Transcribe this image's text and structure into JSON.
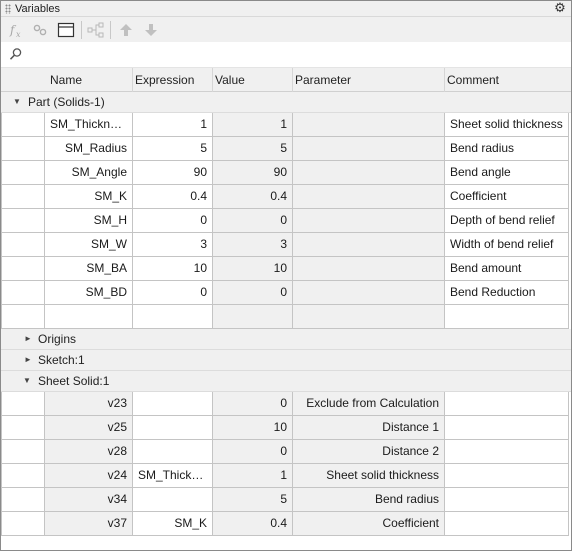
{
  "window": {
    "title": "Variables"
  },
  "toolbar": {
    "buttons": [
      {
        "name": "function-icon"
      },
      {
        "name": "link-icon"
      },
      {
        "name": "window-icon"
      },
      {
        "name": "hierarchy-icon"
      },
      {
        "name": "arrow-up-icon"
      },
      {
        "name": "arrow-down-icon"
      }
    ]
  },
  "search": {
    "value": "",
    "placeholder": ""
  },
  "columns": [
    "Name",
    "Expression",
    "Value",
    "Parameter",
    "Comment"
  ],
  "groups": [
    {
      "label": "Part (Solids-1)",
      "expanded": true,
      "rows": [
        {
          "name": "SM_Thickness",
          "expression": "1",
          "value": "1",
          "parameter": "",
          "comment": "Sheet solid thickness"
        },
        {
          "name": "SM_Radius",
          "expression": "5",
          "value": "5",
          "parameter": "",
          "comment": "Bend radius"
        },
        {
          "name": "SM_Angle",
          "expression": "90",
          "value": "90",
          "parameter": "",
          "comment": "Bend angle"
        },
        {
          "name": "SM_K",
          "expression": "0.4",
          "value": "0.4",
          "parameter": "",
          "comment": "Coefficient"
        },
        {
          "name": "SM_H",
          "expression": "0",
          "value": "0",
          "parameter": "",
          "comment": "Depth of bend relief"
        },
        {
          "name": "SM_W",
          "expression": "3",
          "value": "3",
          "parameter": "",
          "comment": "Width of bend relief"
        },
        {
          "name": "SM_BA",
          "expression": "10",
          "value": "10",
          "parameter": "",
          "comment": "Bend amount"
        },
        {
          "name": "SM_BD",
          "expression": "0",
          "value": "0",
          "parameter": "",
          "comment": "Bend Reduction"
        },
        {
          "name": "",
          "expression": "",
          "value": "",
          "parameter": "",
          "comment": ""
        }
      ]
    },
    {
      "label": "Origins",
      "expanded": false,
      "rows": []
    },
    {
      "label": "Sketch:1",
      "expanded": false,
      "rows": []
    },
    {
      "label": "Sheet Solid:1",
      "expanded": true,
      "rows": [
        {
          "name": "v23",
          "expression": "",
          "value": "0",
          "parameter": "Exclude from Calculation",
          "comment": ""
        },
        {
          "name": "v25",
          "expression": "",
          "value": "10",
          "parameter": "Distance 1",
          "comment": ""
        },
        {
          "name": "v28",
          "expression": "",
          "value": "0",
          "parameter": "Distance 2",
          "comment": ""
        },
        {
          "name": "v24",
          "expression": "SM_Thickn...",
          "value": "1",
          "parameter": "Sheet solid thickness",
          "comment": ""
        },
        {
          "name": "v34",
          "expression": "",
          "value": "5",
          "parameter": "Bend radius",
          "comment": ""
        },
        {
          "name": "v37",
          "expression": "SM_K",
          "value": "0.4",
          "parameter": "Coefficient",
          "comment": ""
        }
      ]
    }
  ],
  "colors": {
    "panel_bg": "#f0f0f0",
    "grid_line": "#c4c4c4",
    "cell_bg": "#ffffff"
  }
}
